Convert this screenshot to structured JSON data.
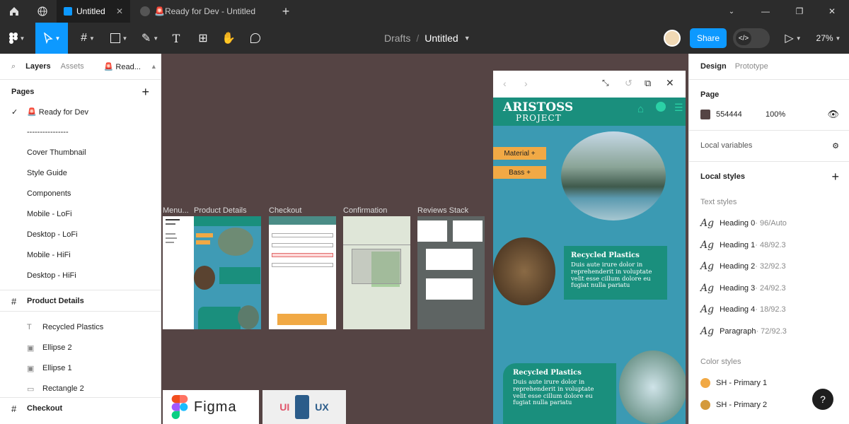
{
  "titlebar": {
    "tab1": "Untitled",
    "tab2": "🚨Ready for Dev - Untitled"
  },
  "toolbar": {
    "breadcrumb_root": "Drafts",
    "breadcrumb_sep": "/",
    "file_name": "Untitled",
    "share": "Share",
    "zoom": "27%"
  },
  "left": {
    "tabs": {
      "layers": "Layers",
      "assets": "Assets",
      "page_short": "🚨 Read..."
    },
    "pages_header": "Pages",
    "pages": [
      "🚨 Ready for Dev",
      "----------------",
      "Cover Thumbnail",
      "Style Guide",
      "Components",
      "Mobile - LoFi",
      "Desktop - LoFi",
      "Mobile - HiFi",
      "Desktop - HiFi"
    ],
    "frame1": "Product Details",
    "layers": [
      "Recycled Plastics",
      "Ellipse 2",
      "Ellipse 1",
      "Rectangle 2"
    ],
    "frame2": "Checkout"
  },
  "canvas": {
    "labels": [
      "Menu...",
      "Product Details",
      "Checkout",
      "Confirmation",
      "Reviews Stack"
    ],
    "logos": {
      "figma": "Figma",
      "ui": "UI",
      "ux": "UX"
    }
  },
  "preview": {
    "brand1": "ARISTOSS",
    "brand2": "PROJECT",
    "chip1": "Material +",
    "chip2": "Bass +",
    "card1_title": "Recycled Plastics",
    "card1_body": "Duis aute irure dolor in reprehenderit in voluptate velit esse cillum dolore eu fugiat nulla pariatu",
    "card2_title": "Recycled Plastics",
    "card2_body": "Duis aute irure dolor in reprehenderit in voluptate velit esse cillum dolore eu fugiat nulla pariatu"
  },
  "right": {
    "tabs": {
      "design": "Design",
      "prototype": "Prototype"
    },
    "page_label": "Page",
    "page_color": "554444",
    "page_opacity": "100%",
    "local_variables": "Local variables",
    "local_styles": "Local styles",
    "text_styles_header": "Text styles",
    "text_styles": [
      {
        "name": "Heading 0",
        "spec": " · 96/Auto"
      },
      {
        "name": "Heading 1",
        "spec": " · 48/92.3"
      },
      {
        "name": "Heading 2",
        "spec": " · 32/92.3"
      },
      {
        "name": "Heading 3",
        "spec": " · 24/92.3"
      },
      {
        "name": "Heading 4",
        "spec": " · 18/92.3"
      },
      {
        "name": "Paragraph",
        "spec": " · 72/92.3"
      }
    ],
    "color_styles_header": "Color styles",
    "color_styles": [
      "SH - Primary 1",
      "SH - Primary 2"
    ],
    "help": "?"
  },
  "colors": {
    "accent": "#0d99ff",
    "canvas": "#554444",
    "teal": "#1a8f7d",
    "chip": "#f1a945",
    "primary1": "#f1a945",
    "primary2": "#d49a3b"
  }
}
